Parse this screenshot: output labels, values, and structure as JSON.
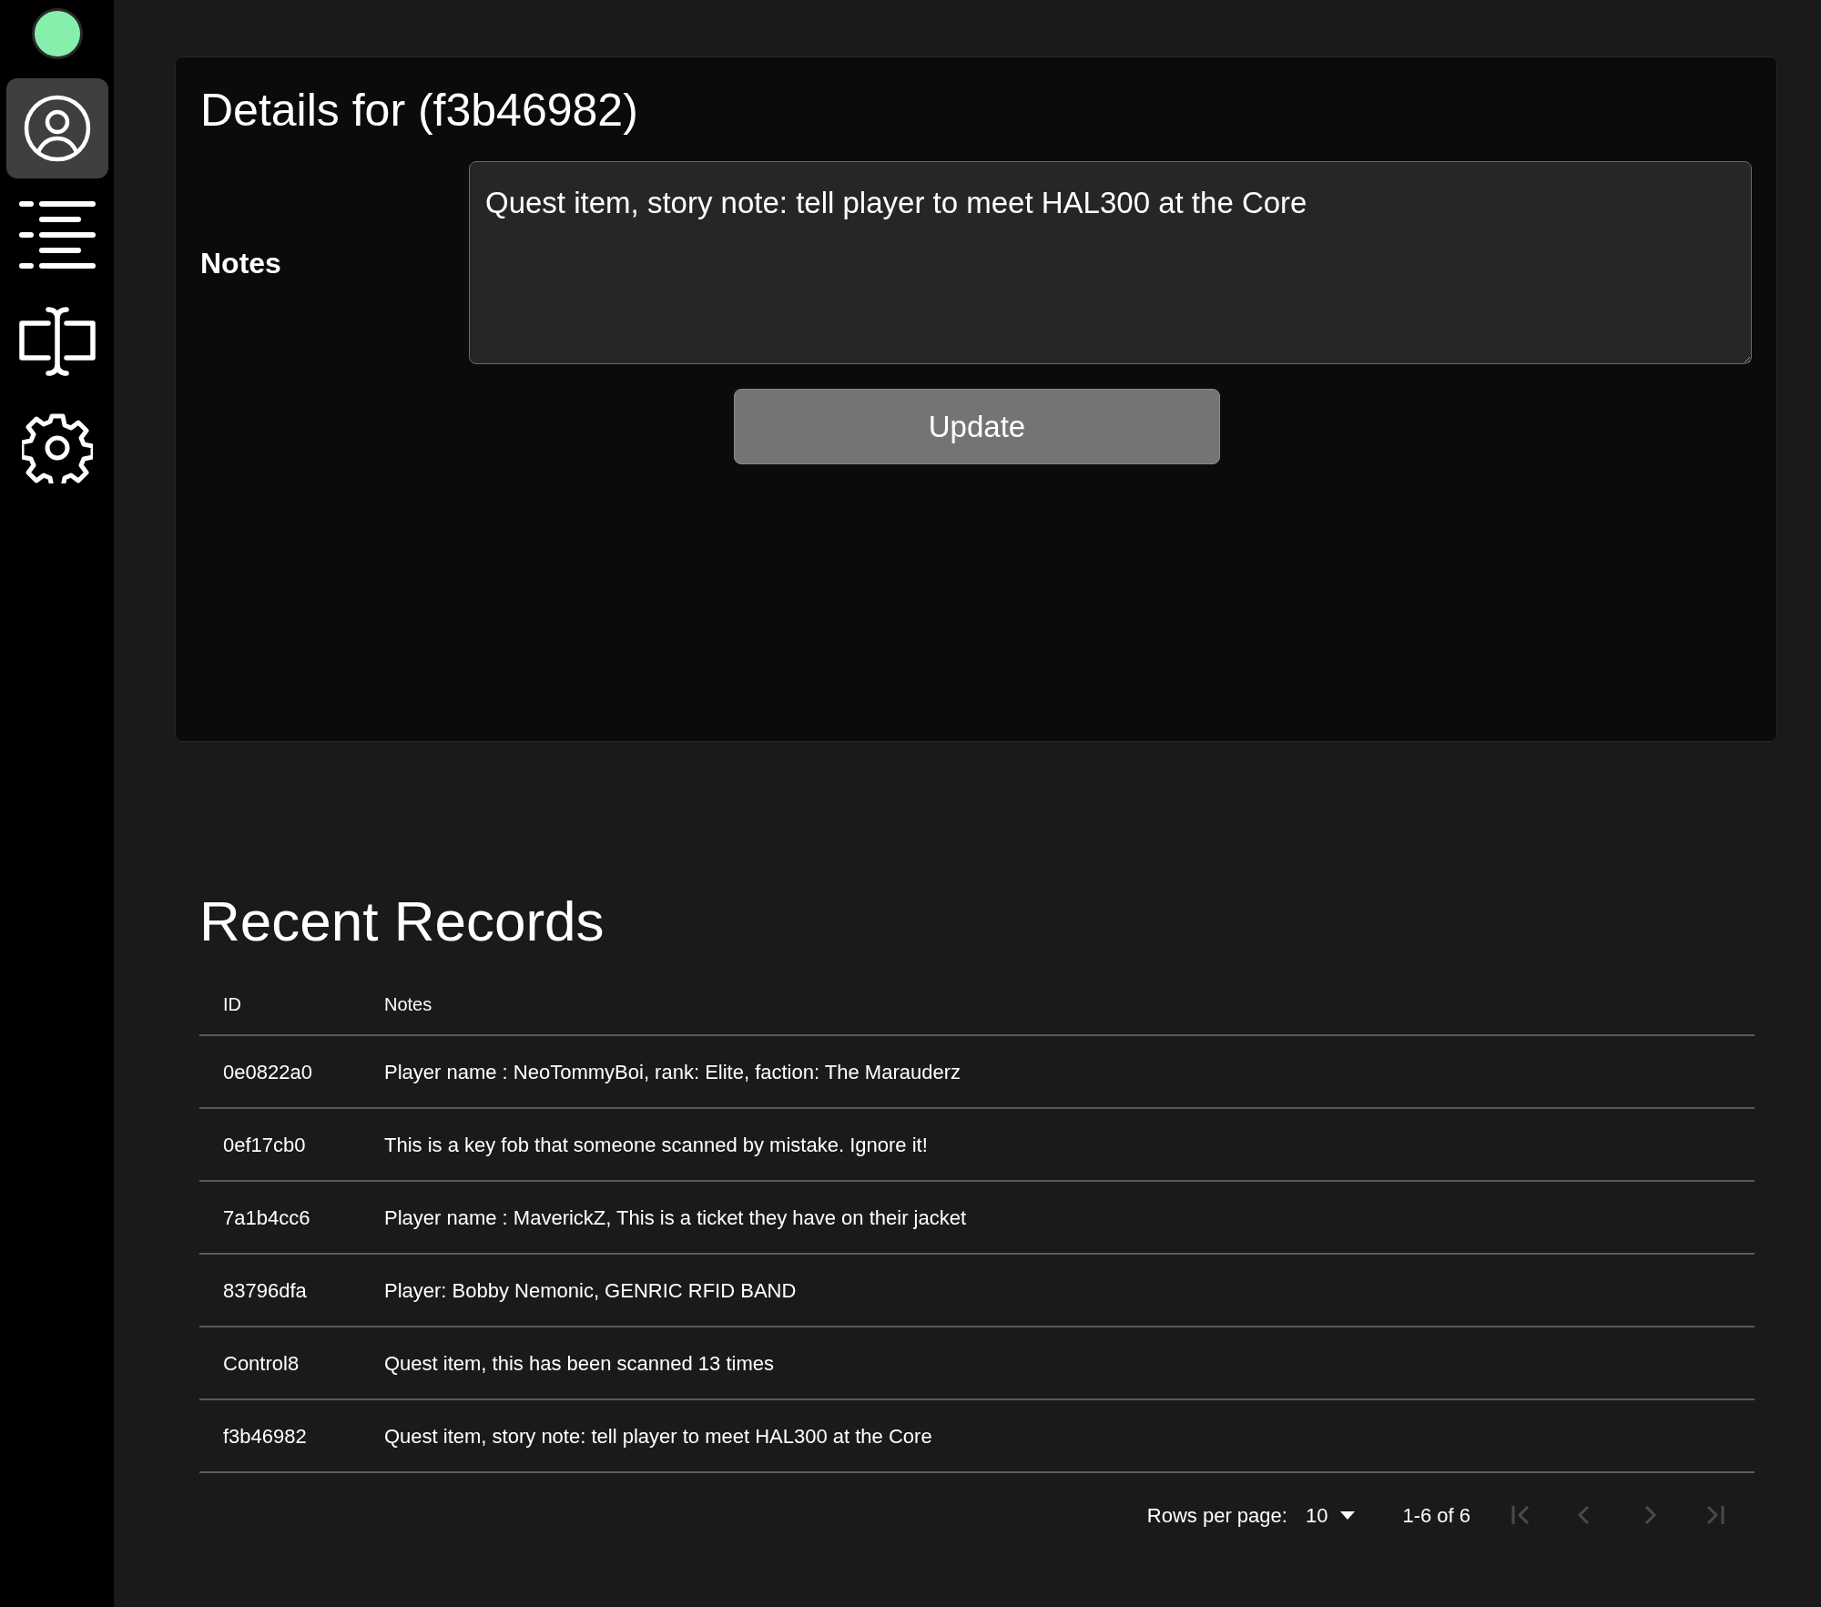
{
  "sidebar": {
    "status_dot": {
      "color": "#86efac"
    },
    "items": [
      {
        "kind": "user",
        "selected": true
      },
      {
        "kind": "list",
        "selected": false
      },
      {
        "kind": "text-cursor",
        "selected": false
      },
      {
        "kind": "settings",
        "selected": false
      }
    ]
  },
  "details": {
    "title": "Details for (f3b46982)",
    "notes_label": "Notes",
    "notes_value": "Quest item, story note: tell player to meet HAL300 at the Core",
    "button": "Update"
  },
  "records": {
    "title": "Recent Records",
    "columns": [
      "ID",
      "Notes"
    ],
    "rows": [
      {
        "id": "0e0822a0",
        "notes": "Player name : NeoTommyBoi, rank: Elite, faction: The Marauderz"
      },
      {
        "id": "0ef17cb0",
        "notes": "This is a key fob that someone scanned by mistake. Ignore it!"
      },
      {
        "id": "7a1b4cc6",
        "notes": "Player name : MaverickZ, This is a ticket they have on their jacket"
      },
      {
        "id": "83796dfa",
        "notes": "Player: Bobby Nemonic, GENRIC RFID BAND"
      },
      {
        "id": "Control8",
        "notes": "Quest item, this has been scanned 13 times"
      },
      {
        "id": "f3b46982",
        "notes": "Quest item, story note: tell player to meet HAL300 at the Core"
      }
    ],
    "pagination": {
      "rows_per_page_label": "Rows per page:",
      "rows_per_page": "10",
      "range": "1-6 of 6",
      "buttons": [
        {
          "kind": "first",
          "disabled": true
        },
        {
          "kind": "prev",
          "disabled": true
        },
        {
          "kind": "next",
          "disabled": true
        },
        {
          "kind": "last",
          "disabled": true
        }
      ]
    }
  }
}
